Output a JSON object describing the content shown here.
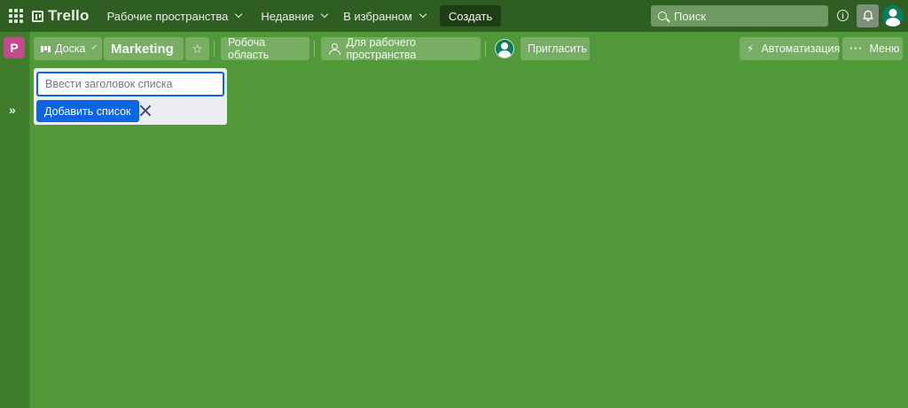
{
  "topnav": {
    "app_name": "Trello",
    "workspaces_label": "Рабочие пространства",
    "recent_label": "Недавние",
    "starred_label": "В избранном",
    "create_label": "Создать",
    "search_placeholder": "Поиск",
    "info_glyph": "i"
  },
  "sidebar": {
    "workspace_initial": "P",
    "expand_glyph": "»"
  },
  "board_header": {
    "view_label": "Доска",
    "board_title": "Marketing",
    "workspace_visibility_label": "Робоча область",
    "for_workspace_label": "Для рабочего пространства",
    "invite_label": "Пригласить",
    "automation_label": "Автоматизация",
    "menu_label": "Меню"
  },
  "add_list": {
    "input_placeholder": "Ввести заголовок списка",
    "input_value": "",
    "add_button_label": "Добавить список"
  },
  "colors": {
    "board_background": "#519839",
    "topnav_background": "#2f5e23",
    "primary_button": "#0c66e4",
    "workspace_badge": "#c44a8e",
    "avatar": "#0a7d5c"
  }
}
